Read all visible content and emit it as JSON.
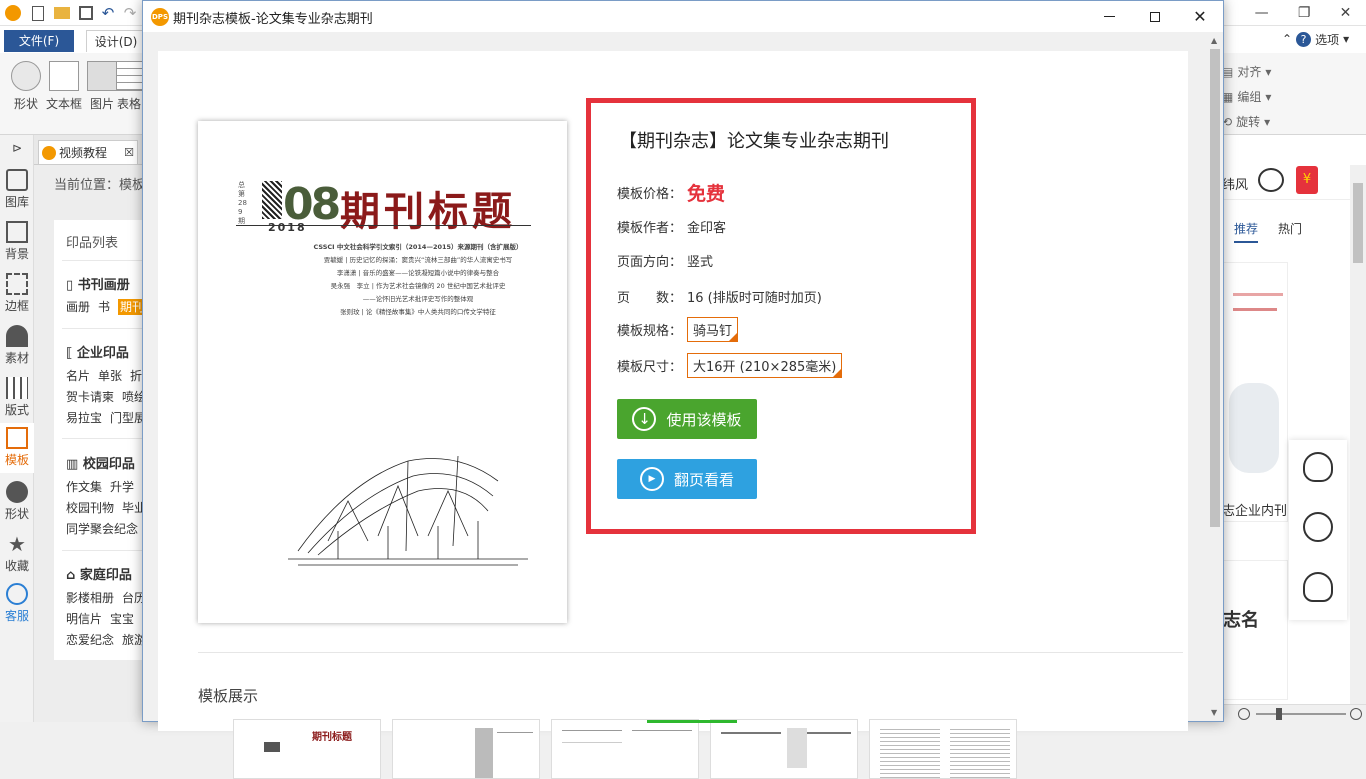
{
  "app": {
    "tabs": {
      "file": "文件(F)",
      "design": "设计(D)"
    },
    "ribbon_tools": [
      "形状",
      "文本框",
      "图片",
      "表格"
    ],
    "ribbon_small": [
      "对齐",
      "编组",
      "旋转"
    ],
    "options_label": "选项",
    "rail": [
      "图库",
      "背景",
      "边框",
      "素材",
      "版式",
      "模板",
      "形状",
      "收藏",
      "客服"
    ],
    "doc_tab": "视频教程",
    "breadcrumb": "当前位置：模板",
    "print_panel": {
      "title": "印品列表",
      "groups": [
        {
          "title": "书刊画册",
          "items": [
            "画册",
            "书",
            "期刊"
          ]
        },
        {
          "title": "企业印品",
          "rows": [
            [
              "名片",
              "单张",
              "折"
            ],
            [
              "贺卡请柬",
              "喷绘"
            ],
            [
              "易拉宝",
              "门型展"
            ]
          ]
        },
        {
          "title": "校园印品",
          "rows": [
            [
              "作文集",
              "升学"
            ],
            [
              "校园刊物",
              "毕业"
            ],
            [
              "同学聚会纪念"
            ]
          ]
        },
        {
          "title": "家庭印品",
          "rows": [
            [
              "影楼相册",
              "台历"
            ],
            [
              "明信片",
              "宝宝"
            ],
            [
              "恋爱纪念",
              "旅游"
            ]
          ]
        }
      ]
    },
    "right": {
      "tab_recommend": "推荐",
      "tab_hot": "热门",
      "banner_text": "志企业内刊",
      "wind_text": "纬风",
      "name_text": "志名"
    }
  },
  "dialog": {
    "title": "期刊杂志模板-论文集专业杂志期刊",
    "logo_text": "DPS",
    "cover": {
      "issue_number": "08",
      "year": "2018",
      "title": "期刊标题",
      "side_text": "总第289期",
      "lines": [
        "CSSCI 中文社会科学引文索引（2014—2015）来源期刊（含扩展版）",
        "贾毓媛 | 历史记忆的探涌：窦贵兴“流林三部曲”的华人流寓史书写",
        "李潇潇 | 音乐的盛宴——论铁凝短篇小说中的律奏与整合",
        "吴永强　李立 | 作为艺术社会镜像的 20 世纪中国艺术批评史",
        "——论怀旧光艺术批评史写作的整体观",
        "张则玟 | 论《精怪故事集》中人类共同的口传文学特征"
      ]
    },
    "info": {
      "heading": "【期刊杂志】论文集专业杂志期刊",
      "price_label": "模板价格：",
      "price_value": "免费",
      "author_label": "模板作者：",
      "author_value": "金印客",
      "orientation_label": "页面方向：",
      "orientation_value": "竖式",
      "pages_label": "页　　数：",
      "pages_value": "16 (排版时可随时加页)",
      "binding_label": "模板规格：",
      "binding_value": "骑马钉",
      "size_label": "模板尺寸：",
      "size_value": "大16开 (210×285毫米)",
      "use_button": "使用该模板",
      "flip_button": "翻页看看"
    },
    "showcase_label": "模板展示",
    "thumb_title": "期刊标题",
    "colors": {
      "price": "#e5323c",
      "use_button": "#4aa52e",
      "flip_button": "#2ea1e0",
      "highlight_border": "#e5323c",
      "tag_border": "#e46c0a"
    }
  }
}
